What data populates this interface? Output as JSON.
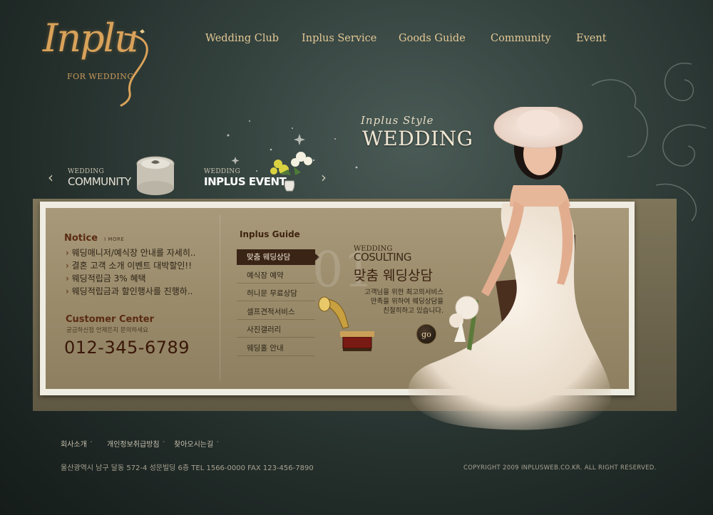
{
  "logo": {
    "script": "Inplu",
    "subtitle": "FOR WEDDING"
  },
  "nav": {
    "items": [
      "Wedding Club",
      "Inplus Service",
      "Goods Guide",
      "Community",
      "Event"
    ]
  },
  "hero": {
    "style_text": "Inplus Style",
    "title": "WEDDING"
  },
  "slider": {
    "items": [
      {
        "small": "WEDDING",
        "big": "COMMUNITY"
      },
      {
        "small": "WEDDING",
        "big": "INPLUS EVENT"
      }
    ]
  },
  "notice": {
    "title": "Notice",
    "more": "I MORE",
    "items": [
      "웨딩매니저/예식장 안내를 자세히..",
      "결혼 고객 소개 이벤트 대박할인!!",
      "웨딩적립금 3% 혜택",
      "웨딩적립금과 할인행사를 진행하.."
    ]
  },
  "customer_center": {
    "title": "Customer Center",
    "subtitle": "궁금하신점 언제든지 문의하세요",
    "phone": "012-345-6789"
  },
  "guide": {
    "title": "Inplus Guide",
    "items": [
      "맞춤 웨딩상담",
      "예식장 예약",
      "허니문 무료상담",
      "셀프견적서비스",
      "사진갤러리",
      "웨딩홀 안내"
    ],
    "active_index": 0
  },
  "feature": {
    "number": "01",
    "label_small": "WEDDING",
    "label_en": "COSULTING",
    "label_ko": "맞춤 웨딩상담",
    "desc_lines": [
      "고객님을 위한 최고의서비스",
      "만족을 위하여 웨딩상담을",
      "친절히하고 있습니다."
    ],
    "go_label": "go"
  },
  "footer": {
    "links": [
      "회사소개",
      "개인정보취급방침",
      "찾아오시는길"
    ],
    "address": "울산광역시 남구 달동 572-4 성문빌딩 6층   TEL 1566-0000   FAX 123-456-7890",
    "copyright": "COPYRIGHT 2009 INPLUSWEB.CO.KR. ALL RIGHT RESERVED."
  },
  "colors": {
    "background": "#2b3733",
    "gold": "#d9a25a",
    "panel": "#a8997a",
    "accent_dark": "#3a2416"
  }
}
